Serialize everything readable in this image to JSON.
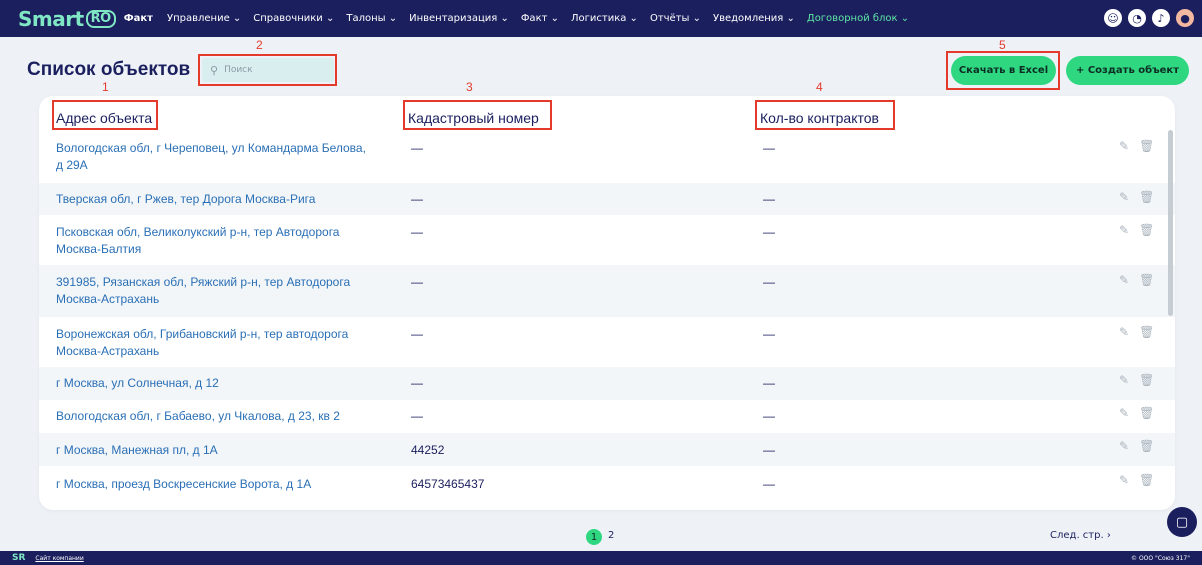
{
  "topbar": {
    "logo_main": "Smart",
    "logo_ro": "RO",
    "brand_sub": "Факт",
    "nav": [
      {
        "label": "Управление ⌄"
      },
      {
        "label": "Справочники ⌄"
      },
      {
        "label": "Талоны ⌄"
      },
      {
        "label": "Инвентаризация ⌄"
      },
      {
        "label": "Факт ⌄"
      },
      {
        "label": "Логистика ⌄"
      },
      {
        "label": "Отчёты ⌄"
      },
      {
        "label": "Уведомления ⌄"
      },
      {
        "label": "Договорной блок ⌄"
      }
    ],
    "icons": [
      "support-icon",
      "compass-icon",
      "bell-icon",
      "user-avatar"
    ]
  },
  "header": {
    "title": "Список объектов",
    "search_placeholder": "Поиск",
    "excel_label": "Скачать в Excel",
    "create_label": "+ Создать объект"
  },
  "annotations": [
    "1",
    "2",
    "3",
    "4",
    "5"
  ],
  "table": {
    "columns": [
      "Адрес объекта",
      "Кадастровый номер",
      "Кол-во контрактов"
    ],
    "rows": [
      {
        "addr": "Вологодская обл, г Череповец, ул Командарма Белова, д 29А",
        "cad": "—",
        "cnt": "—"
      },
      {
        "addr": "Тверская обл, г Ржев, тер Дорога Москва-Рига",
        "cad": "—",
        "cnt": "—"
      },
      {
        "addr": "Псковская обл, Великолукский р-н, тер Автодорога Москва-Балтия",
        "cad": "—",
        "cnt": "—"
      },
      {
        "addr": "391985, Рязанская обл, Ряжский р-н, тер Автодорога Москва-Астрахань",
        "cad": "—",
        "cnt": "—"
      },
      {
        "addr": "Воронежская обл, Грибановский р-н, тер автодорога Москва-Астрахань",
        "cad": "—",
        "cnt": "—"
      },
      {
        "addr": "г Москва, ул Солнечная, д 12",
        "cad": "—",
        "cnt": "—"
      },
      {
        "addr": "Вологодская обл, г Бабаево, ул Чкалова, д 23, кв 2",
        "cad": "—",
        "cnt": "—"
      },
      {
        "addr": "г Москва, Манежная пл, д 1А",
        "cad": "44252",
        "cnt": "—"
      },
      {
        "addr": "г Москва, проезд Воскресенские Ворота, д 1А",
        "cad": "64573465437",
        "cnt": "—"
      }
    ],
    "edit_icon": "✎",
    "delete_icon": "🗑"
  },
  "pagination": {
    "pages": [
      "1",
      "2"
    ],
    "current": "1",
    "next_label": "След. стр. ›"
  },
  "footer": {
    "logo": "SR",
    "site_link": "Сайт компании",
    "copyright": "© ООО \"Союз 317\""
  },
  "colors": {
    "navy": "#1b1f5e",
    "accent_green": "#2fd780",
    "annotation_red": "#e33a2c",
    "link_blue": "#2a6fb5"
  }
}
